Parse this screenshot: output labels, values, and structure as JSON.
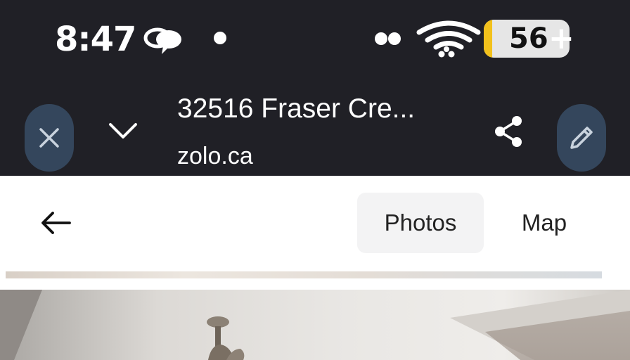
{
  "status_bar": {
    "time": "8:47",
    "battery_percent": "56",
    "battery_plus": "+",
    "icons": [
      "message-icon",
      "notification-dot-icon",
      "dual-sim-icon",
      "wifi-icon",
      "battery-icon"
    ]
  },
  "toolbar": {
    "title": "32516 Fraser Cre...",
    "domain": "zolo.ca",
    "icons": [
      "close-icon",
      "chevron-down-icon",
      "share-icon",
      "edit-icon"
    ]
  },
  "page_header": {
    "icons": [
      "back-arrow-icon"
    ],
    "tabs": [
      {
        "label": "Photos",
        "selected": true
      },
      {
        "label": "Map",
        "selected": false
      }
    ]
  },
  "colors": {
    "dark_background": "#202026",
    "pill_button": "#34465c",
    "selected_tab_bg": "#f3f3f4",
    "battery_accent": "#f2c11c"
  }
}
